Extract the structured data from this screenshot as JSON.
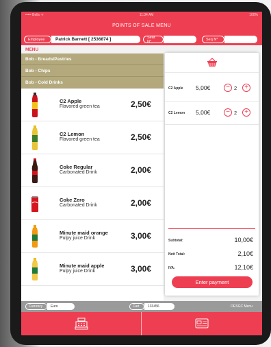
{
  "status_bar": {
    "left": "••••• Bells ᯤ",
    "time": "11:34 AM",
    "battery": "100%"
  },
  "header": {
    "title": "POINTS OF SALE MENU",
    "employee_label": "Employee",
    "employee_value": "Patrick Barnett  [ 2536874 ]",
    "seat_label": "Seat N°",
    "seat_value": "",
    "seq_label": "Seq N°",
    "seq_value": ""
  },
  "menu": {
    "label": "MENU",
    "categories": [
      "Bob - Breads/Pastries",
      "Bob - Chips",
      "Bob - Cold Drinks"
    ],
    "products": [
      {
        "name": "C2 Apple",
        "desc": "Flavored green tea",
        "price": "2,50€"
      },
      {
        "name": "C2 Lemon",
        "desc": "Flavored green tea",
        "price": "2,50€"
      },
      {
        "name": "Coke Regular",
        "desc": "Carbonated Drink",
        "price": "2,00€"
      },
      {
        "name": "Coke Zero",
        "desc": "Carbonated Drink",
        "price": "2,00€"
      },
      {
        "name": "Minute maid orange",
        "desc": "Pulpy juice Drink",
        "price": "3,00€"
      },
      {
        "name": "Minute maid apple",
        "desc": "Pulpy juice Drink",
        "price": "3,00€"
      }
    ]
  },
  "order": {
    "lines": [
      {
        "name": "C2 Apple",
        "price": "5,00€",
        "qty": "2"
      },
      {
        "name": "C2 Lemon",
        "price": "5,00€",
        "qty": "2"
      }
    ],
    "subtotal_label": "Subtotal:",
    "subtotal_value": "10,00€",
    "nett_label": "Nett Total:",
    "nett_value": "2,10€",
    "iva_label": "IVA:",
    "iva_value": "12,10€",
    "enter_payment": "Enter payment"
  },
  "footer": {
    "currency_label": "Currency",
    "currency_value": "Euro",
    "cart_label": "Cart",
    "cart_value": "133456",
    "menu_label": "OESGC Menu"
  },
  "icons": {
    "basket": "basket-icon",
    "register": "cash-register-icon",
    "card": "credit-card-icon"
  },
  "colors": {
    "accent": "#ee3f52",
    "category": "#b3a97d"
  }
}
